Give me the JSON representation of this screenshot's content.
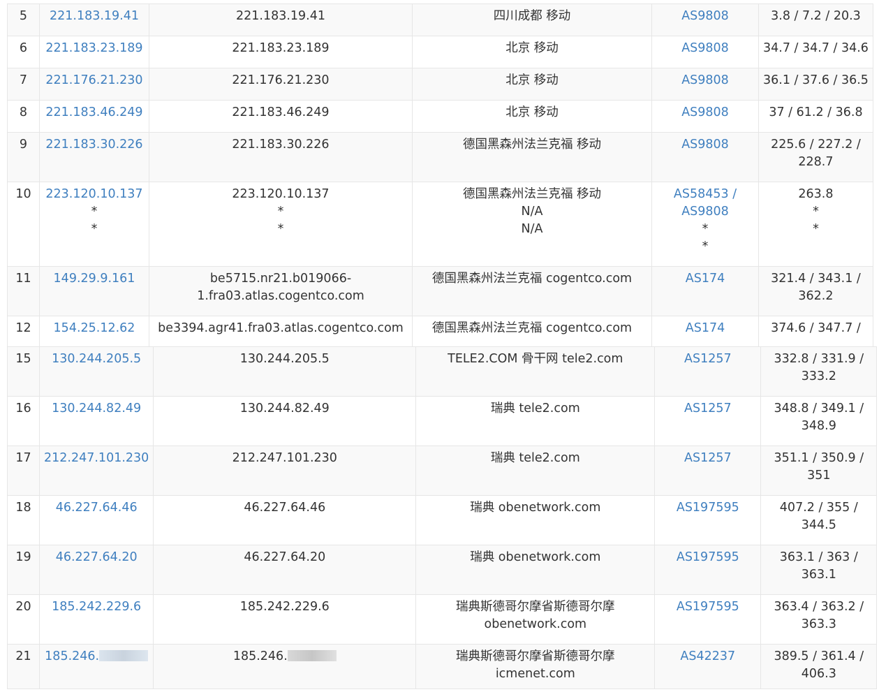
{
  "colors": {
    "link": "#3f7fbf",
    "text": "#333333",
    "border": "#e6e6e6",
    "row_alt": "#f9f9f9"
  },
  "table_top": {
    "rows": [
      {
        "hop": "5",
        "ip": [
          "221.183.19.41"
        ],
        "host": [
          "221.183.19.41"
        ],
        "location": [
          "四川成都 移动"
        ],
        "asn": [
          "AS9808"
        ],
        "latency": [
          "3.8 / 7.2 / 20.3"
        ]
      },
      {
        "hop": "6",
        "ip": [
          "221.183.23.189"
        ],
        "host": [
          "221.183.23.189"
        ],
        "location": [
          "北京 移动"
        ],
        "asn": [
          "AS9808"
        ],
        "latency": [
          "34.7 / 34.7 / 34.6"
        ]
      },
      {
        "hop": "7",
        "ip": [
          "221.176.21.230"
        ],
        "host": [
          "221.176.21.230"
        ],
        "location": [
          "北京 移动"
        ],
        "asn": [
          "AS9808"
        ],
        "latency": [
          "36.1 / 37.6 / 36.5"
        ]
      },
      {
        "hop": "8",
        "ip": [
          "221.183.46.249"
        ],
        "host": [
          "221.183.46.249"
        ],
        "location": [
          "北京 移动"
        ],
        "asn": [
          "AS9808"
        ],
        "latency": [
          "37 / 61.2 / 36.8"
        ]
      },
      {
        "hop": "9",
        "ip": [
          "221.183.30.226"
        ],
        "host": [
          "221.183.30.226"
        ],
        "location": [
          "德国黑森州法兰克福 移动"
        ],
        "asn": [
          "AS9808"
        ],
        "latency": [
          "225.6 / 227.2 /",
          "228.7"
        ]
      },
      {
        "hop": "10",
        "ip": [
          "223.120.10.137",
          "*",
          "*"
        ],
        "host": [
          "223.120.10.137",
          "*",
          "*"
        ],
        "location": [
          "德国黑森州法兰克福 移动",
          "N/A",
          "N/A"
        ],
        "asn": [
          "AS58453 /",
          "AS9808",
          "*",
          "*"
        ],
        "latency": [
          "263.8",
          "*",
          "*"
        ]
      },
      {
        "hop": "11",
        "ip": [
          "149.29.9.161"
        ],
        "host": [
          "be5715.nr21.b019066-",
          "1.fra03.atlas.cogentco.com"
        ],
        "location": [
          "德国黑森州法兰克福 cogentco.com"
        ],
        "asn": [
          "AS174"
        ],
        "latency": [
          "321.4 / 343.1 /",
          "362.2"
        ]
      },
      {
        "hop": "12",
        "ip": [
          "154.25.12.62"
        ],
        "host": [
          "be3394.agr41.fra03.atlas.cogentco.com"
        ],
        "location": [
          "德国黑森州法兰克福 cogentco.com"
        ],
        "asn": [
          "AS174"
        ],
        "latency": [
          "374.6 / 347.7 /"
        ]
      }
    ]
  },
  "table_bottom": {
    "rows": [
      {
        "hop": "15",
        "ip": [
          "130.244.205.5"
        ],
        "host": [
          "130.244.205.5"
        ],
        "location": [
          "TELE2.COM 骨干网 tele2.com"
        ],
        "asn": [
          "AS1257"
        ],
        "latency": [
          "332.8 / 331.9 /",
          "333.2"
        ]
      },
      {
        "hop": "16",
        "ip": [
          "130.244.82.49"
        ],
        "host": [
          "130.244.82.49"
        ],
        "location": [
          "瑞典 tele2.com"
        ],
        "asn": [
          "AS1257"
        ],
        "latency": [
          "348.8 / 349.1 /",
          "348.9"
        ]
      },
      {
        "hop": "17",
        "ip": [
          "212.247.101.230"
        ],
        "host": [
          "212.247.101.230"
        ],
        "location": [
          "瑞典 tele2.com"
        ],
        "asn": [
          "AS1257"
        ],
        "latency": [
          "351.1 / 350.9 /",
          "351"
        ]
      },
      {
        "hop": "18",
        "ip": [
          "46.227.64.46"
        ],
        "host": [
          "46.227.64.46"
        ],
        "location": [
          "瑞典 obenetwork.com"
        ],
        "asn": [
          "AS197595"
        ],
        "latency": [
          "407.2 / 355 /",
          "344.5"
        ]
      },
      {
        "hop": "19",
        "ip": [
          "46.227.64.20"
        ],
        "host": [
          "46.227.64.20"
        ],
        "location": [
          "瑞典 obenetwork.com"
        ],
        "asn": [
          "AS197595"
        ],
        "latency": [
          "363.1 / 363 /",
          "363.1"
        ]
      },
      {
        "hop": "20",
        "ip": [
          "185.242.229.6"
        ],
        "host": [
          "185.242.229.6"
        ],
        "location": [
          "瑞典斯德哥尔摩省斯德哥尔摩",
          "obenetwork.com"
        ],
        "asn": [
          "AS197595"
        ],
        "latency": [
          "363.4 / 363.2 /",
          "363.3"
        ]
      },
      {
        "hop": "21",
        "ip": [
          "185.246."
        ],
        "host": [
          "185.246."
        ],
        "location": [
          "瑞典斯德哥尔摩省斯德哥尔摩",
          "icmenet.com"
        ],
        "asn": [
          "AS42237"
        ],
        "latency": [
          "389.5 / 361.4 /",
          "406.3"
        ],
        "redacted": true
      }
    ]
  }
}
